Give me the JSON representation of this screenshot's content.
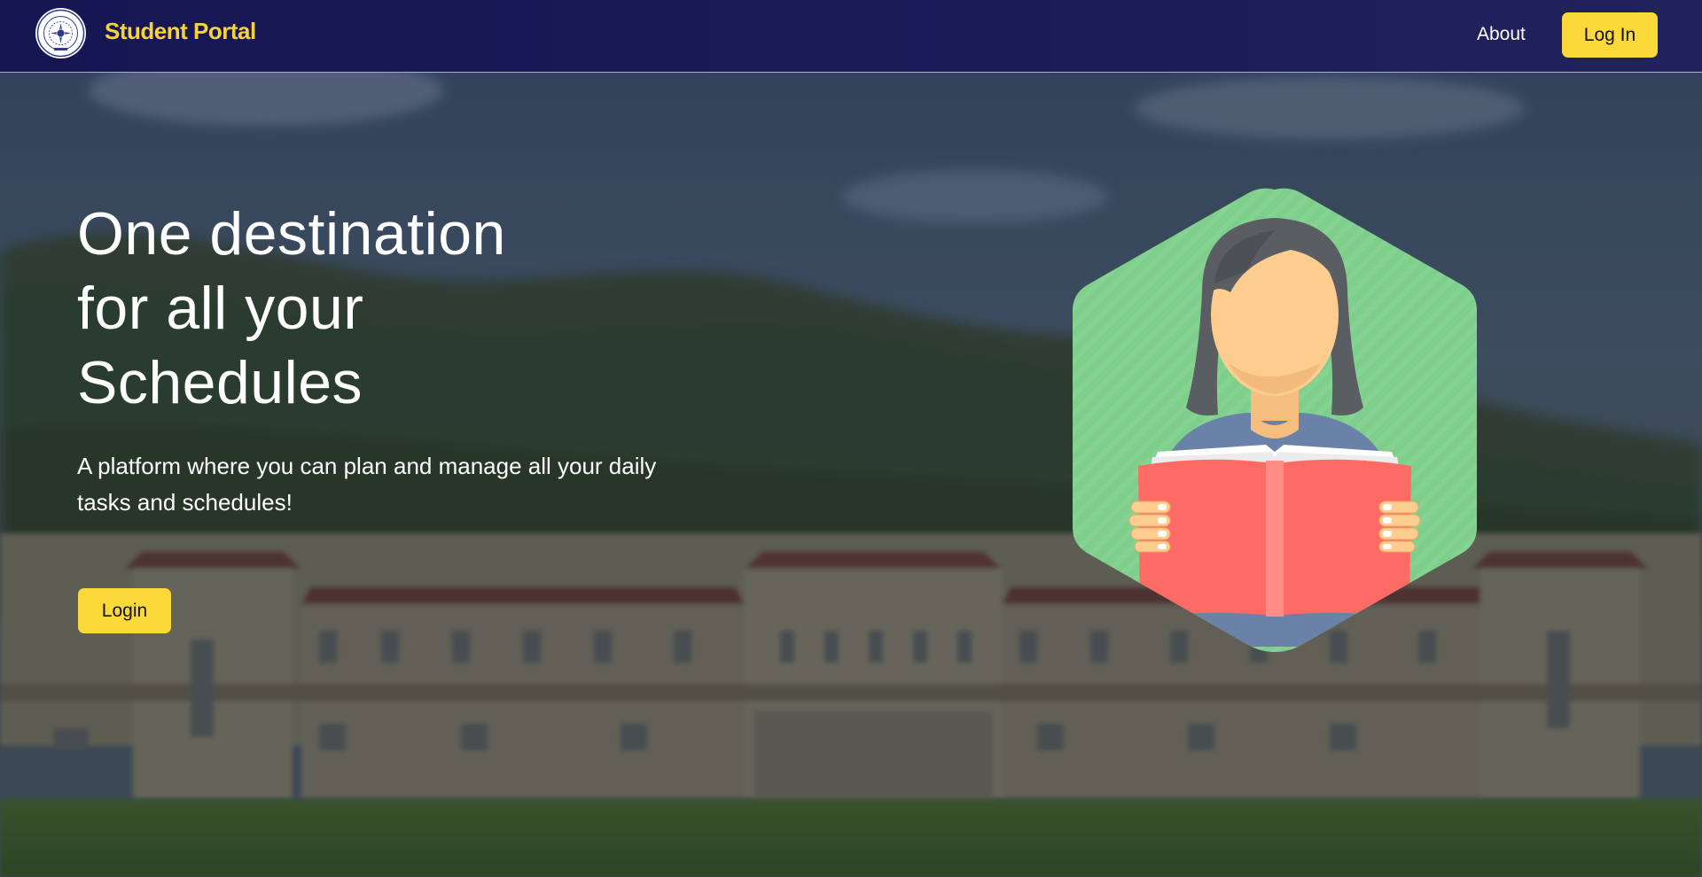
{
  "header": {
    "brand": "Student Portal",
    "about_label": "About",
    "login_label": "Log In",
    "logo_icon": "university-seal-icon"
  },
  "hero": {
    "title_lines": [
      "One destination",
      "for all your",
      "Schedules"
    ],
    "subtitle_lines": [
      "A platform where you can plan and manage all your daily",
      "tasks and schedules!"
    ],
    "cta_label": "Login",
    "illustration_icon": "student-reading-book-icon",
    "background": "blurred-campus-building-photo"
  },
  "colors": {
    "navbar": "#1a1a56",
    "accent": "#fbd93b",
    "brand_text": "#f6d33b",
    "hexagon": "#7ecf8c",
    "book": "#fe6b64"
  }
}
